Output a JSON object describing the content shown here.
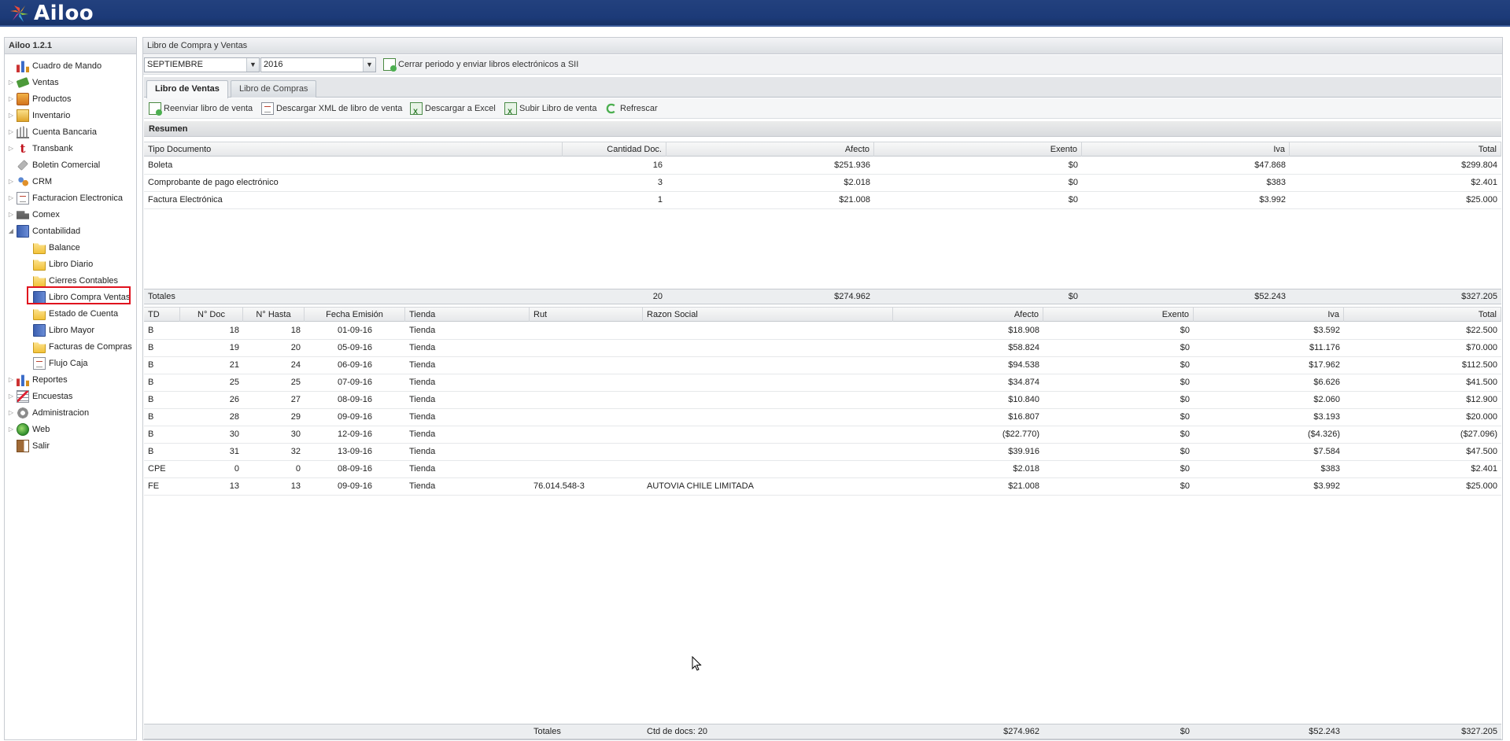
{
  "app": {
    "name": "Ailoo"
  },
  "sidebar": {
    "title": "Ailoo 1.2.1",
    "items": [
      {
        "label": "Cuadro de Mando",
        "icon": "chart-icon",
        "expandable": false
      },
      {
        "label": "Ventas",
        "icon": "money-icon",
        "expandable": true
      },
      {
        "label": "Productos",
        "icon": "products-icon",
        "expandable": true
      },
      {
        "label": "Inventario",
        "icon": "inventory-box-icon",
        "expandable": true
      },
      {
        "label": "Cuenta Bancaria",
        "icon": "bank-icon",
        "expandable": true
      },
      {
        "label": "Transbank",
        "icon": "transbank-icon",
        "expandable": true
      },
      {
        "label": "Boletin Comercial",
        "icon": "tag-icon",
        "expandable": false
      },
      {
        "label": "CRM",
        "icon": "crm-icon",
        "expandable": true
      },
      {
        "label": "Facturacion Electronica",
        "icon": "invoice-doc-icon",
        "expandable": true
      },
      {
        "label": "Comex",
        "icon": "truck-icon",
        "expandable": true
      },
      {
        "label": "Contabilidad",
        "icon": "accounting-book-icon",
        "expandable": true,
        "expanded": true
      },
      {
        "label": "Balance",
        "icon": "folder-icon",
        "child": true
      },
      {
        "label": "Libro Diario",
        "icon": "folder-icon",
        "child": true
      },
      {
        "label": "Cierres Contables",
        "icon": "folder-icon",
        "child": true
      },
      {
        "label": "Libro Compra Ventas",
        "icon": "book-icon",
        "child": true,
        "selected": true
      },
      {
        "label": "Estado de Cuenta",
        "icon": "folder-icon",
        "child": true
      },
      {
        "label": "Libro Mayor",
        "icon": "book-icon",
        "child": true
      },
      {
        "label": "Facturas de Compras",
        "icon": "folder-icon",
        "child": true
      },
      {
        "label": "Flujo Caja",
        "icon": "document-icon",
        "child": true
      },
      {
        "label": "Reportes",
        "icon": "chart-icon",
        "expandable": true
      },
      {
        "label": "Encuestas",
        "icon": "survey-icon",
        "expandable": true
      },
      {
        "label": "Administracion",
        "icon": "gear-icon",
        "expandable": true
      },
      {
        "label": "Web",
        "icon": "web-globe-icon",
        "expandable": true
      },
      {
        "label": "Salir",
        "icon": "exit-icon",
        "expandable": false
      }
    ]
  },
  "main": {
    "title": "Libro de Compra y Ventas",
    "filters": {
      "month": "SEPTIEMBRE",
      "year": "2016",
      "close_period_label": "Cerrar periodo y enviar libros electrónicos a SII"
    },
    "tabs": [
      {
        "label": "Libro de Ventas",
        "active": true
      },
      {
        "label": "Libro de Compras",
        "active": false
      }
    ],
    "actions": [
      {
        "label": "Reenviar libro de venta",
        "icon": "resend-icon"
      },
      {
        "label": "Descargar XML de libro de venta",
        "icon": "xml-document-icon"
      },
      {
        "label": "Descargar a Excel",
        "icon": "excel-icon"
      },
      {
        "label": "Subir Libro de venta",
        "icon": "upload-excel-icon"
      },
      {
        "label": "Refrescar",
        "icon": "refresh-icon"
      }
    ],
    "summary": {
      "title": "Resumen",
      "columns": [
        "Tipo Documento",
        "Cantidad Doc.",
        "Afecto",
        "Exento",
        "Iva",
        "Total"
      ],
      "rows": [
        [
          "Boleta",
          "16",
          "$251.936",
          "$0",
          "$47.868",
          "$299.804"
        ],
        [
          "Comprobante de pago electrónico",
          "3",
          "$2.018",
          "$0",
          "$383",
          "$2.401"
        ],
        [
          "Factura Electrónica",
          "1",
          "$21.008",
          "$0",
          "$3.992",
          "$25.000"
        ]
      ],
      "totals": [
        "Totales",
        "20",
        "$274.962",
        "$0",
        "$52.243",
        "$327.205"
      ]
    },
    "detail": {
      "columns": [
        "TD",
        "N° Doc",
        "N° Hasta",
        "Fecha Emisión",
        "Tienda",
        "Rut",
        "Razon Social",
        "Afecto",
        "Exento",
        "Iva",
        "Total"
      ],
      "rows": [
        [
          "B",
          "18",
          "18",
          "01-09-16",
          "Tienda",
          "",
          "",
          "$18.908",
          "$0",
          "$3.592",
          "$22.500"
        ],
        [
          "B",
          "19",
          "20",
          "05-09-16",
          "Tienda",
          "",
          "",
          "$58.824",
          "$0",
          "$11.176",
          "$70.000"
        ],
        [
          "B",
          "21",
          "24",
          "06-09-16",
          "Tienda",
          "",
          "",
          "$94.538",
          "$0",
          "$17.962",
          "$112.500"
        ],
        [
          "B",
          "25",
          "25",
          "07-09-16",
          "Tienda",
          "",
          "",
          "$34.874",
          "$0",
          "$6.626",
          "$41.500"
        ],
        [
          "B",
          "26",
          "27",
          "08-09-16",
          "Tienda",
          "",
          "",
          "$10.840",
          "$0",
          "$2.060",
          "$12.900"
        ],
        [
          "B",
          "28",
          "29",
          "09-09-16",
          "Tienda",
          "",
          "",
          "$16.807",
          "$0",
          "$3.193",
          "$20.000"
        ],
        [
          "B",
          "30",
          "30",
          "12-09-16",
          "Tienda",
          "",
          "",
          "($22.770)",
          "$0",
          "($4.326)",
          "($27.096)"
        ],
        [
          "B",
          "31",
          "32",
          "13-09-16",
          "Tienda",
          "",
          "",
          "$39.916",
          "$0",
          "$7.584",
          "$47.500"
        ],
        [
          "CPE",
          "0",
          "0",
          "08-09-16",
          "Tienda",
          "",
          "",
          "$2.018",
          "$0",
          "$383",
          "$2.401"
        ],
        [
          "FE",
          "13",
          "13",
          "09-09-16",
          "Tienda",
          "76.014.548-3",
          "AUTOVIA CHILE LIMITADA",
          "$21.008",
          "$0",
          "$3.992",
          "$25.000"
        ]
      ],
      "totals": {
        "label": "Totales",
        "count": "Ctd de docs: 20",
        "afecto": "$274.962",
        "exento": "$0",
        "iva": "$52.243",
        "total": "$327.205"
      }
    }
  },
  "colors": {
    "header_bg": "#1c3a78",
    "selection_outline": "#e0121e",
    "panel_border": "#c7cbd1"
  }
}
